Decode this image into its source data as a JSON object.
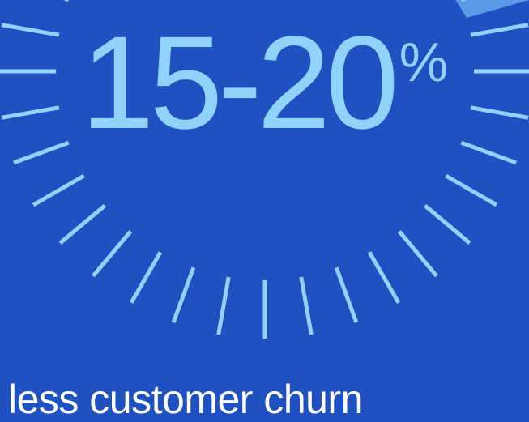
{
  "stat": {
    "value": "15-20",
    "unit": "%"
  },
  "caption": "less customer churn",
  "gauge": {
    "tick_color": "#8fd3fb",
    "accent_color": "#5b9ae6",
    "background": "#1f52c0"
  }
}
